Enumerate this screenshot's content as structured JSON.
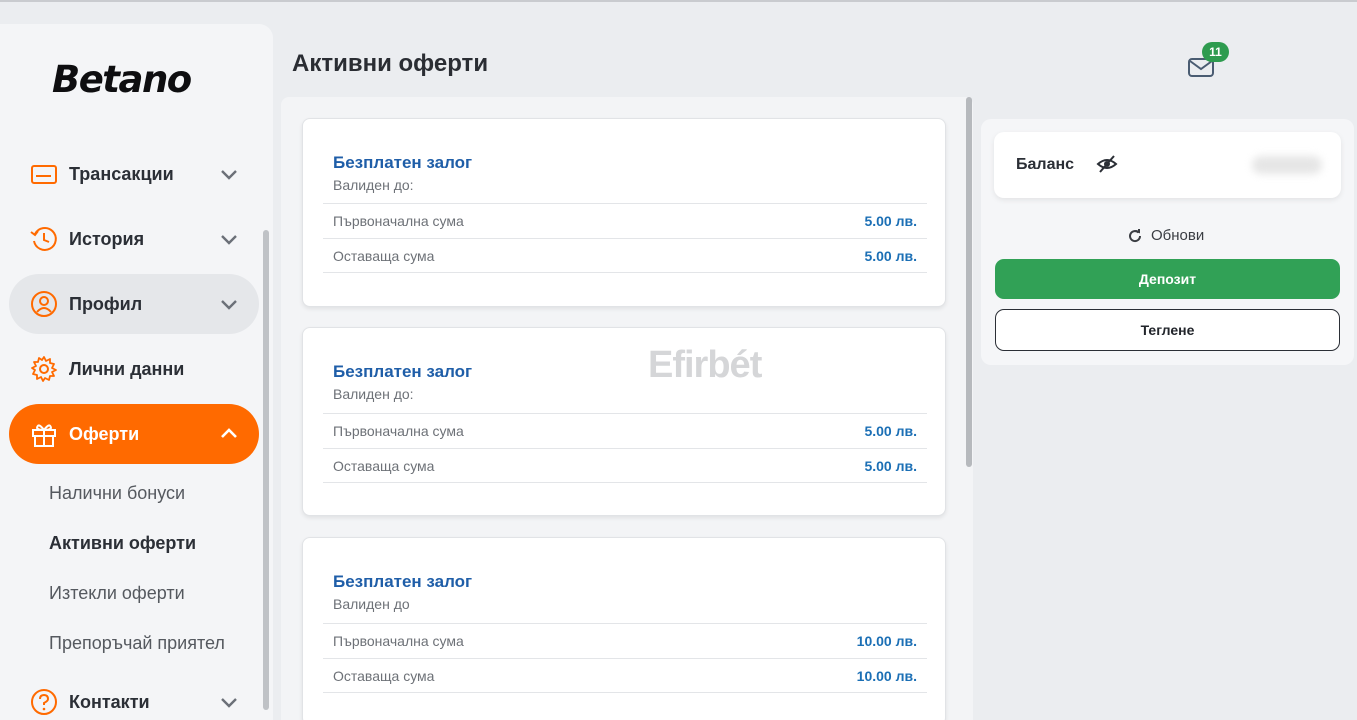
{
  "brand": {
    "logo": "Betano",
    "accent": "#ff6a00"
  },
  "sidebar": {
    "items": [
      {
        "label": "Трансакции",
        "icon": "wallet-icon"
      },
      {
        "label": "История",
        "icon": "history-icon"
      },
      {
        "label": "Профил",
        "icon": "user-icon"
      },
      {
        "label": "Лични данни",
        "icon": "gear-icon"
      },
      {
        "label": "Оферти",
        "icon": "gift-icon"
      },
      {
        "label": "Контакти",
        "icon": "help-icon"
      }
    ],
    "sub_items": [
      {
        "label": "Налични бонуси"
      },
      {
        "label": "Активни оферти"
      },
      {
        "label": "Изтекли оферти"
      },
      {
        "label": "Препоръчай приятел"
      }
    ]
  },
  "main": {
    "title": "Активни оферти",
    "watermark": "Efirbét",
    "offers": [
      {
        "title": "Безплатен залог",
        "valid": "Валиден до:",
        "rows": [
          {
            "label": "Първоначална сума",
            "value": "5.00 лв."
          },
          {
            "label": "Оставаща сума",
            "value": "5.00 лв."
          }
        ]
      },
      {
        "title": "Безплатен залог",
        "valid": "Валиден до:",
        "rows": [
          {
            "label": "Първоначална сума",
            "value": "5.00 лв."
          },
          {
            "label": "Оставаща сума",
            "value": "5.00 лв."
          }
        ]
      },
      {
        "title": "Безплатен залог",
        "valid": "Валиден до",
        "rows": [
          {
            "label": "Първоначална сума",
            "value": "10.00 лв."
          },
          {
            "label": "Оставаща сума",
            "value": "10.00 лв."
          }
        ]
      }
    ]
  },
  "header": {
    "mail_count": "11"
  },
  "wallet": {
    "balance_label": "Баланс",
    "refresh_label": "Обнови",
    "deposit_label": "Депозит",
    "withdraw_label": "Теглене"
  }
}
